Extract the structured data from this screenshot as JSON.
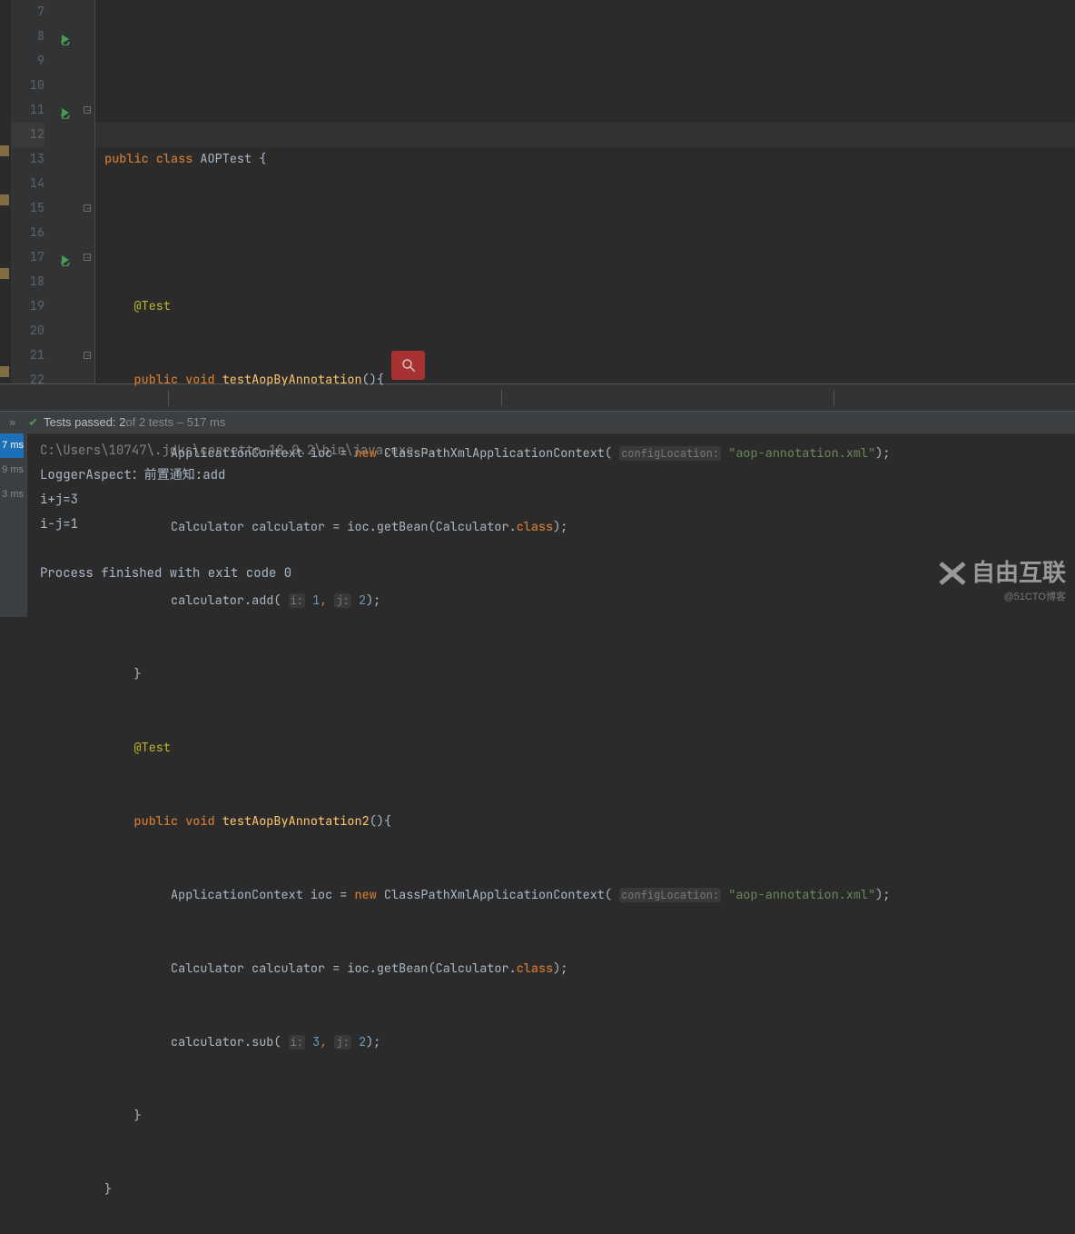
{
  "gutter": {
    "start": 7,
    "end": 22
  },
  "code": {
    "l7": "",
    "l8": {
      "kw1": "public ",
      "kw2": "class ",
      "cls": "AOPTest ",
      "br": "{"
    },
    "l9": "",
    "l10": {
      "ann": "@Test"
    },
    "l11": {
      "kw1": "public ",
      "kw2": "void ",
      "m": "testAopByAnnotation",
      "p": "(){"
    },
    "l12": {
      "t1": "ApplicationContext ioc = ",
      "kwnew": "new ",
      "t2": "ClassPathXmlApplicationContext( ",
      "hint": "configLocation:",
      "str": "\"aop-annotation.xml\"",
      "end": ");"
    },
    "l13": {
      "t1": "Calculator calculator = ioc.getBean(Calculator.",
      "fld": "class",
      "end": ");"
    },
    "l14": {
      "t1": "calculator.add( ",
      "h1": "i:",
      "n1": "1",
      "c": ", ",
      "h2": "j:",
      "n2": "2",
      "end": ");"
    },
    "l15": {
      "br": "}"
    },
    "l16": {
      "ann": "@Test"
    },
    "l17": {
      "kw1": "public ",
      "kw2": "void ",
      "m": "testAopByAnnotation2",
      "p": "(){"
    },
    "l18": {
      "t1": "ApplicationContext ioc = ",
      "kwnew": "new ",
      "t2": "ClassPathXmlApplicationContext( ",
      "hint": "configLocation:",
      "str": "\"aop-annotation.xml\"",
      "end": ");"
    },
    "l19": {
      "t1": "Calculator calculator = ioc.getBean(Calculator.",
      "fld": "class",
      "end": ");"
    },
    "l20": {
      "t1": "calculator.sub( ",
      "h1": "i:",
      "n1": "3",
      "c": ", ",
      "h2": "j:",
      "n2": "2",
      "end": ");"
    },
    "l21": {
      "br": "}"
    },
    "l22": {
      "br": "}"
    }
  },
  "tests_bar": {
    "chevron": "»",
    "label_prefix": "Tests passed: ",
    "passed": "2",
    "label_mid": " of 2 tests – ",
    "duration": "517 ms"
  },
  "tree": {
    "items": [
      "7 ms",
      "9 ms",
      "3 ms"
    ]
  },
  "console": {
    "l1": "C:\\Users\\10747\\.jdks\\corretto-18.0.2\\bin\\java.exe ...",
    "l2": "LoggerAspect：前置通知:add",
    "l3": "i+j=3",
    "l4": "i-j=1",
    "l5": "",
    "l6": "Process finished with exit code 0"
  },
  "watermark": {
    "title": "自由互联",
    "sub": "@51CTO博客"
  }
}
